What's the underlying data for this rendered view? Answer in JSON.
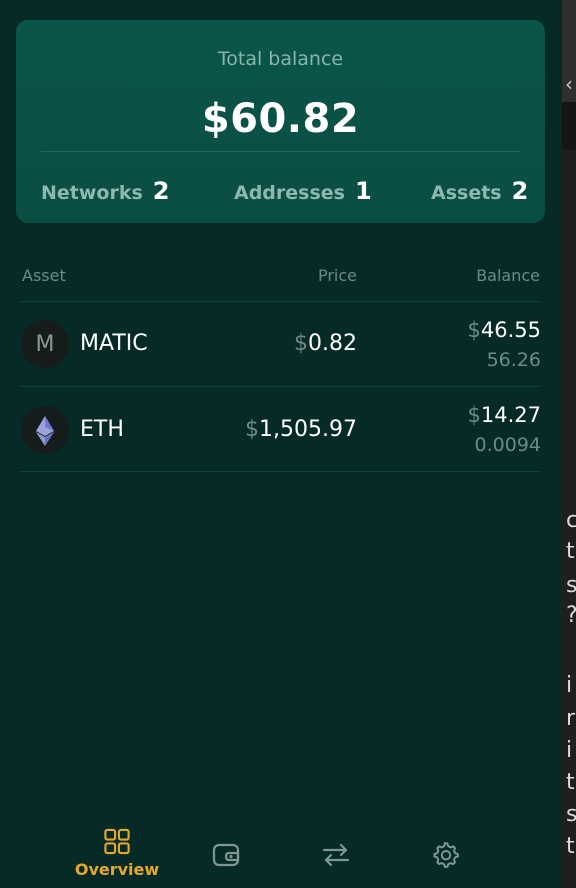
{
  "summary": {
    "label": "Total balance",
    "amount": "$60.82",
    "networks_label": "Networks",
    "networks_value": "2",
    "addresses_label": "Addresses",
    "addresses_value": "1",
    "assets_label": "Assets",
    "assets_value": "2"
  },
  "table": {
    "headers": {
      "asset": "Asset",
      "price": "Price",
      "balance": "Balance"
    },
    "rows": [
      {
        "icon_letter": "M",
        "icon": "matic-token-icon",
        "symbol": "MATIC",
        "price_currency": "$",
        "price": "0.82",
        "balance_currency": "$",
        "balance_value": "46.55",
        "balance_amount": "56.26"
      },
      {
        "icon": "eth-diamond-icon",
        "symbol": "ETH",
        "price_currency": "$",
        "price": "1,505.97",
        "balance_currency": "$",
        "balance_value": "14.27",
        "balance_amount": "0.0094"
      }
    ]
  },
  "nav": {
    "overview_label": "Overview",
    "active_color": "#e6a72e",
    "icons": [
      "grid-icon",
      "wallet-icon",
      "swap-arrows-icon",
      "gear-icon"
    ]
  },
  "background_letters": [
    "c",
    "t",
    "s",
    "?",
    "i",
    "r",
    "i",
    "t",
    "s",
    "t"
  ]
}
